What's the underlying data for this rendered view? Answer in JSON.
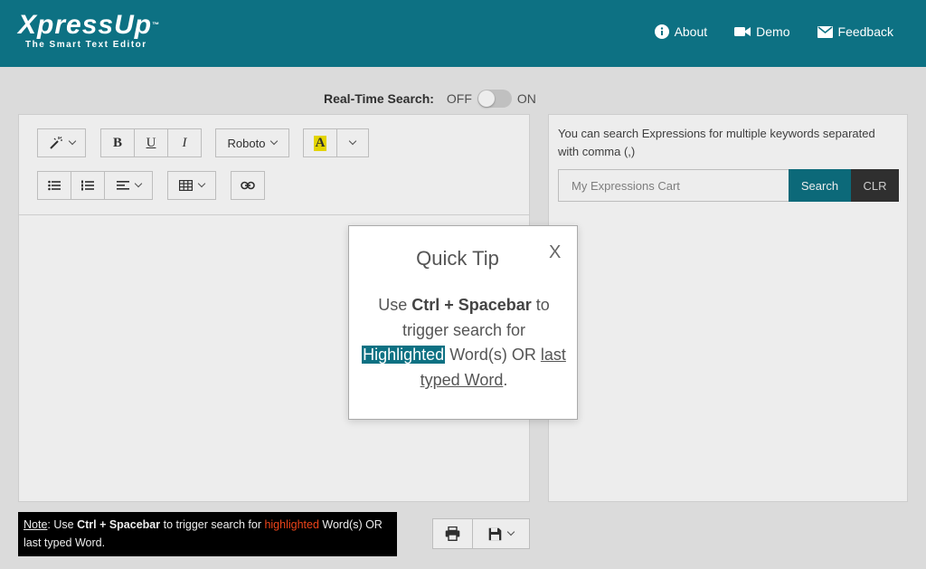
{
  "header": {
    "logo_main": "XpressUp",
    "logo_tm": "™",
    "logo_sub": "The Smart Text Editor",
    "nav": [
      {
        "label": "About",
        "icon": "info-icon"
      },
      {
        "label": "Demo",
        "icon": "video-camera-icon"
      },
      {
        "label": "Feedback",
        "icon": "mail-icon"
      }
    ]
  },
  "realtime_search": {
    "label": "Real-Time Search:",
    "off": "OFF",
    "on": "ON",
    "state": "off"
  },
  "toolbar": {
    "magic_icon": "magic-wand-icon",
    "bold": "B",
    "underline": "U",
    "italic": "I",
    "font": "Roboto",
    "color_letter": "A",
    "color_highlight": "#f5e500"
  },
  "search_panel": {
    "hint": "You can search Expressions for multiple keywords separated with comma (,)",
    "placeholder": "My Expressions Cart",
    "search_label": "Search",
    "clear_label": "CLR"
  },
  "note": {
    "label": "Note",
    "t1": ": Use ",
    "keys": "Ctrl + Spacebar",
    "t2": " to trigger search for ",
    "highlighted": "highlighted",
    "t3": " Word(s) OR last typed Word."
  },
  "modal": {
    "title": "Quick Tip",
    "close": "X",
    "use": "Use ",
    "keys": "Ctrl + Spacebar",
    "to_trigger": " to trigger search for ",
    "highlighted": "Highlighted",
    "words_or": " Word(s) OR ",
    "last_typed": "last typed Word",
    "period": "."
  },
  "colors": {
    "brand": "#0d7183",
    "note_highlight": "#ff4a1c"
  }
}
